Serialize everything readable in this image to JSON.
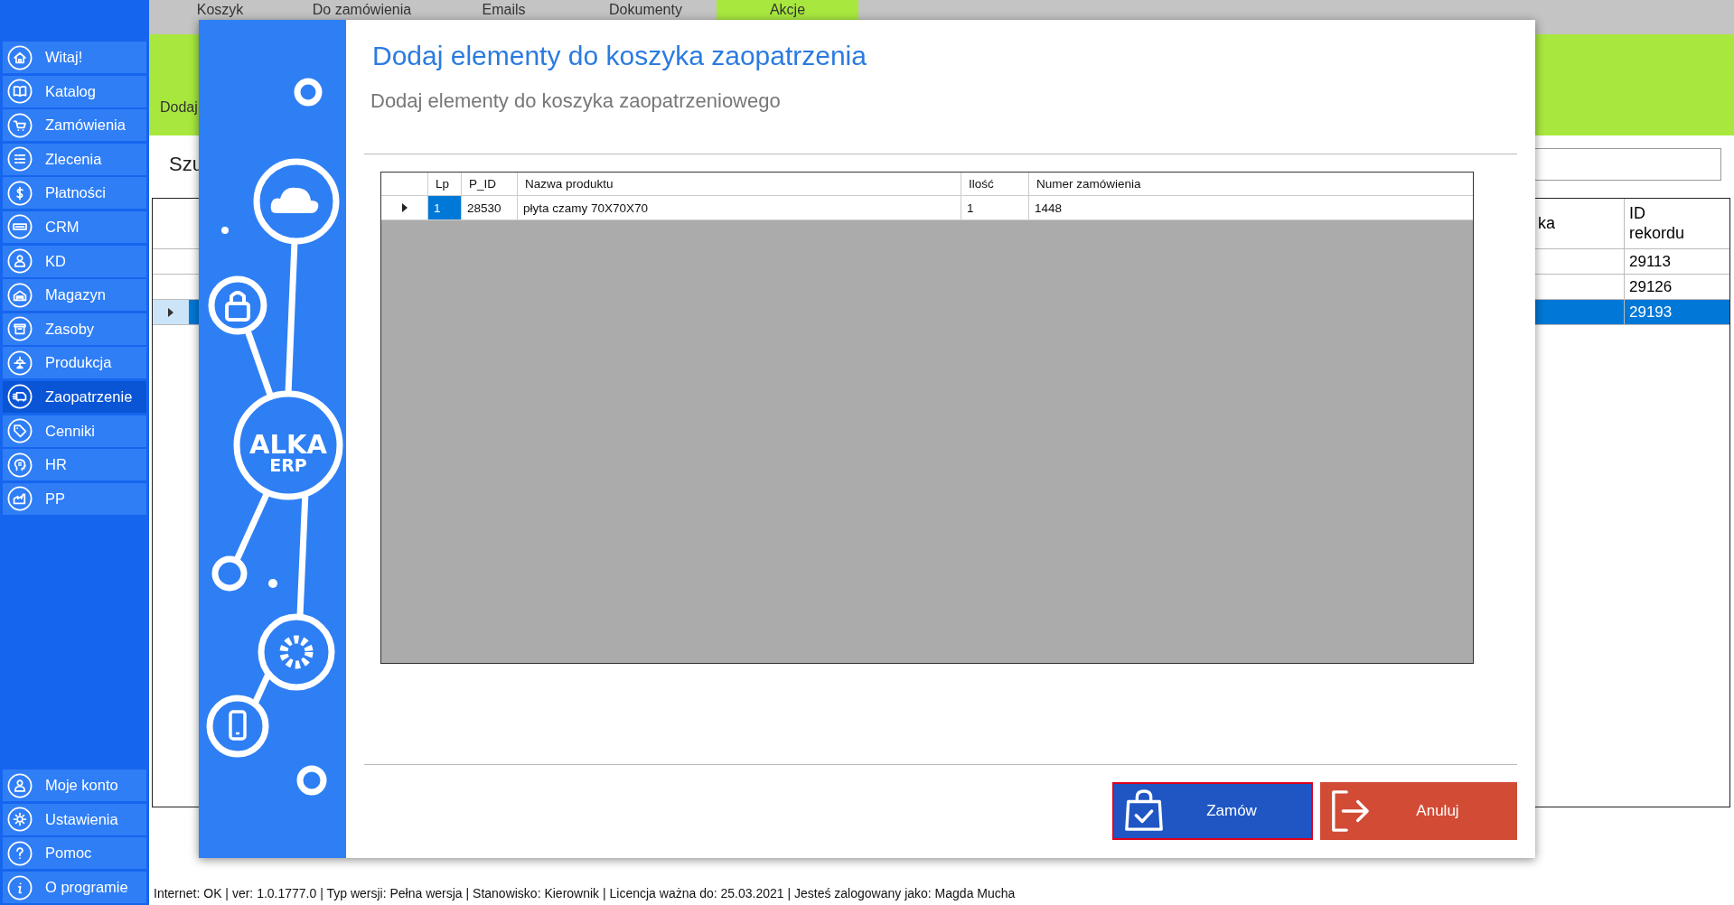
{
  "sidebar": {
    "items": [
      {
        "label": "Witaj!",
        "selected": false
      },
      {
        "label": "Katalog",
        "selected": false
      },
      {
        "label": "Zamówienia",
        "selected": false
      },
      {
        "label": "Zlecenia",
        "selected": false
      },
      {
        "label": "Płatności",
        "selected": false
      },
      {
        "label": "CRM",
        "selected": false
      },
      {
        "label": "KD",
        "selected": false
      },
      {
        "label": "Magazyn",
        "selected": false
      },
      {
        "label": "Zasoby",
        "selected": false
      },
      {
        "label": "Produkcja",
        "selected": false
      },
      {
        "label": "Zaopatrzenie",
        "selected": true
      },
      {
        "label": "Cenniki",
        "selected": false
      },
      {
        "label": "HR",
        "selected": false
      },
      {
        "label": "PP",
        "selected": false
      }
    ],
    "bottom_items": [
      {
        "label": "Moje konto",
        "selected": false
      },
      {
        "label": "Ustawienia",
        "selected": false
      },
      {
        "label": "Pomoc",
        "selected": false
      },
      {
        "label": "O programie",
        "selected": false
      }
    ]
  },
  "tabs": [
    {
      "label": "Koszyk",
      "selected": false
    },
    {
      "label": "Do zamówienia",
      "selected": false
    },
    {
      "label": "Emails",
      "selected": false
    },
    {
      "label": "Dokumenty",
      "selected": false
    },
    {
      "label": "Akcje",
      "selected": true
    }
  ],
  "background": {
    "breadcrumb": "Dodaj",
    "search_label": "Szu",
    "table": {
      "columns": [
        "ka",
        "ID rekordu"
      ],
      "rows": [
        {
          "id": "29113",
          "selected": false
        },
        {
          "id": "29126",
          "selected": false
        },
        {
          "id": "29193",
          "selected": true
        }
      ]
    }
  },
  "dialog": {
    "title": "Dodaj elementy do koszyka zaopatrzenia",
    "subtitle": "Dodaj elementy do koszyka zaopatrzeniowego",
    "logo": [
      "ALKA",
      "ERP"
    ],
    "grid": {
      "columns": [
        "Lp",
        "P_ID",
        "Nazwa produktu",
        "Ilość",
        "Numer zamówienia"
      ],
      "rows": [
        {
          "current": true,
          "cells": [
            {
              "text": "1",
              "selected": true
            },
            {
              "text": "28530",
              "selected": false
            },
            {
              "text": "płyta czamy 70X70X70",
              "selected": false
            },
            {
              "text": "1",
              "selected": false
            },
            {
              "text": "1448",
              "selected": false
            }
          ]
        }
      ]
    },
    "buttons": [
      {
        "label": "Zamów",
        "kind": "confirm",
        "focused": true
      },
      {
        "label": "Anuluj",
        "kind": "cancel",
        "focused": false
      }
    ]
  },
  "status_bar": "Internet: OK  |  ver: 1.0.1777.0  |  Typ wersji: Pełna wersja  |  Stanowisko: Kierownik  |  Licencja ważna do: 25.03.2021  |  Jesteś zalogowany jako: Magda Mucha"
}
